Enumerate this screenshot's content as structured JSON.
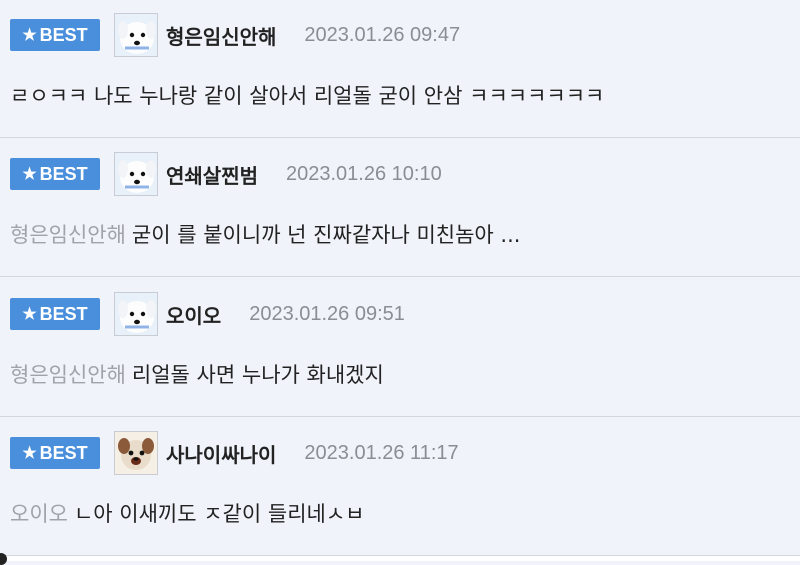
{
  "comments": [
    {
      "badge": "BEST",
      "avatar": "dog-avatar",
      "username": "형은임신안해",
      "timestamp": "2023.01.26 09:47",
      "reply_to": "",
      "text": "ㄹㅇㅋㅋ 나도 누나랑 같이 살아서 리얼돌 굳이 안삼 ㅋㅋㅋㅋㅋㅋㅋ"
    },
    {
      "badge": "BEST",
      "avatar": "dog-avatar",
      "username": "연쇄살찐범",
      "timestamp": "2023.01.26 10:10",
      "reply_to": "형은임신안해",
      "text": "굳이 를 붙이니까 넌 진짜같자나 미친놈아 ..."
    },
    {
      "badge": "BEST",
      "avatar": "dog-avatar",
      "username": "오이오",
      "timestamp": "2023.01.26 09:51",
      "reply_to": "형은임신안해",
      "text": "리얼돌 사면 누나가 화내겠지"
    },
    {
      "badge": "BEST",
      "avatar": "puppy-face-avatar",
      "username": "사나이싸나이",
      "timestamp": "2023.01.26 11:17",
      "reply_to": "오이오",
      "text": "ㄴ아 이새끼도 ㅈ같이 들리네ㅅㅂ"
    }
  ],
  "colors": {
    "badge": "#4a8fdc",
    "background": "#f0f3fa",
    "mention": "#a0a3a8",
    "timestamp": "#8a8d93"
  }
}
